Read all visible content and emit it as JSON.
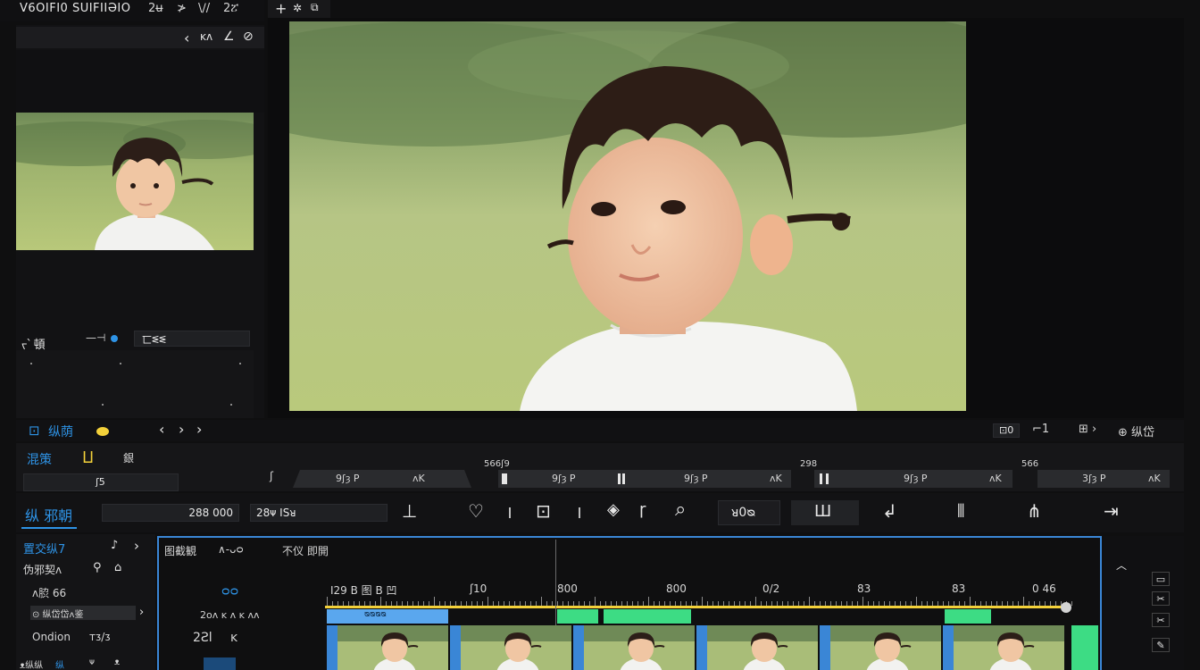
{
  "colors": {
    "accent": "#2e93e6",
    "playhead": "#f3d13a",
    "clip_blue": "#5aa7ee",
    "clip_green": "#3ddc84",
    "clip_border": "#3a86d6"
  },
  "top_left_header": {
    "title": "V6OIFI0 SUIFIIƏIO",
    "controls": [
      "2ʉ",
      "≯",
      "\\∕/",
      "2ፘ"
    ]
  },
  "viewer_toolbar": {
    "icons": [
      "plus-icon",
      "fx-icon",
      "copy-icon"
    ]
  },
  "left_panel_toolbar": [
    "‹",
    "ᴋᴧ",
    "∠",
    "⊘"
  ],
  "left_properties": {
    "label": "ᠵ՝ 頓",
    "slider_value": "—⊣",
    "field_value": "匸ᓬᓬ"
  },
  "timeline_header": {
    "title": "纵荫",
    "nav_prev": "‹",
    "nav_next": "›",
    "nav_next2": "›",
    "right_a": "⊡0",
    "right_b": "⌐1",
    "right_c": "⊞ ›",
    "right_d": "⊕ 纵岱"
  },
  "row2": {
    "tab_active": "混策",
    "tab_icon": "Ⳙ",
    "tab_b": "銀",
    "field_label": "ʃ5",
    "marker_a": "ʃ",
    "segments": [
      {
        "label": "9ʃȝ P",
        "tail": "ᴧK",
        "caption": ""
      },
      {
        "label": "9ʃȝ P",
        "tail": "",
        "caption": "566ʃ9"
      },
      {
        "label": "9ʃȝ P",
        "tail": "ᴧK",
        "caption": ""
      },
      {
        "label": "9ʃȝ P",
        "tail": "ᴧK",
        "caption": "298"
      },
      {
        "label": "3ʃȝ P",
        "tail": "ᴧK",
        "caption": "566"
      }
    ]
  },
  "toolbar": {
    "title": "纵 邪朝",
    "duration": "288 000",
    "timecode": "28ᴪ ISᴚ",
    "zoom_value": "ᴚ0ᴓ",
    "tools": [
      "split-icon",
      "heart-icon",
      "crop-icon",
      "marker-icon",
      "brush-icon",
      "zoom-icon",
      "keyframe-icon",
      "undo-icon",
      "trim-icon",
      "magnet-icon",
      "export-icon"
    ]
  },
  "tracks_panel": {
    "header": "置交纵7",
    "rows": [
      {
        "label": "伪邪契ᴧ",
        "value": ""
      },
      {
        "label": "ᴧ䏮 66",
        "value": ""
      },
      {
        "label": "⊙ 纵岱岱ᴧ鉴",
        "value": "›"
      },
      {
        "label": "Ondion",
        "value": "ᴛᴣ/ᴣ"
      }
    ],
    "footer": [
      "ᴥ纵纵",
      "纵",
      "ᴪ",
      "ᴥ"
    ]
  },
  "timeline": {
    "header_left": "图截観",
    "header_mid": "∧-ᴗᴑ",
    "header_right": "不仪 即開",
    "value_a": "ᴑᴑ",
    "value_b": "2oᴧ ᴋ ᴧ ᴋ ᴧᴧ",
    "value_c": "2Ƨl",
    "value_d": "ᴋ",
    "ruler_labels": [
      "I29 B 图 B 凹",
      "ʃ10",
      "800",
      "800",
      "0/2",
      "83",
      "83",
      "0 46"
    ],
    "clips": [
      {
        "color": "blue",
        "label": "ᴓᴓᴓᴓ"
      },
      {
        "color": "green",
        "label": ""
      },
      {
        "color": "green",
        "label": ""
      },
      {
        "color": "green",
        "label": ""
      }
    ]
  }
}
